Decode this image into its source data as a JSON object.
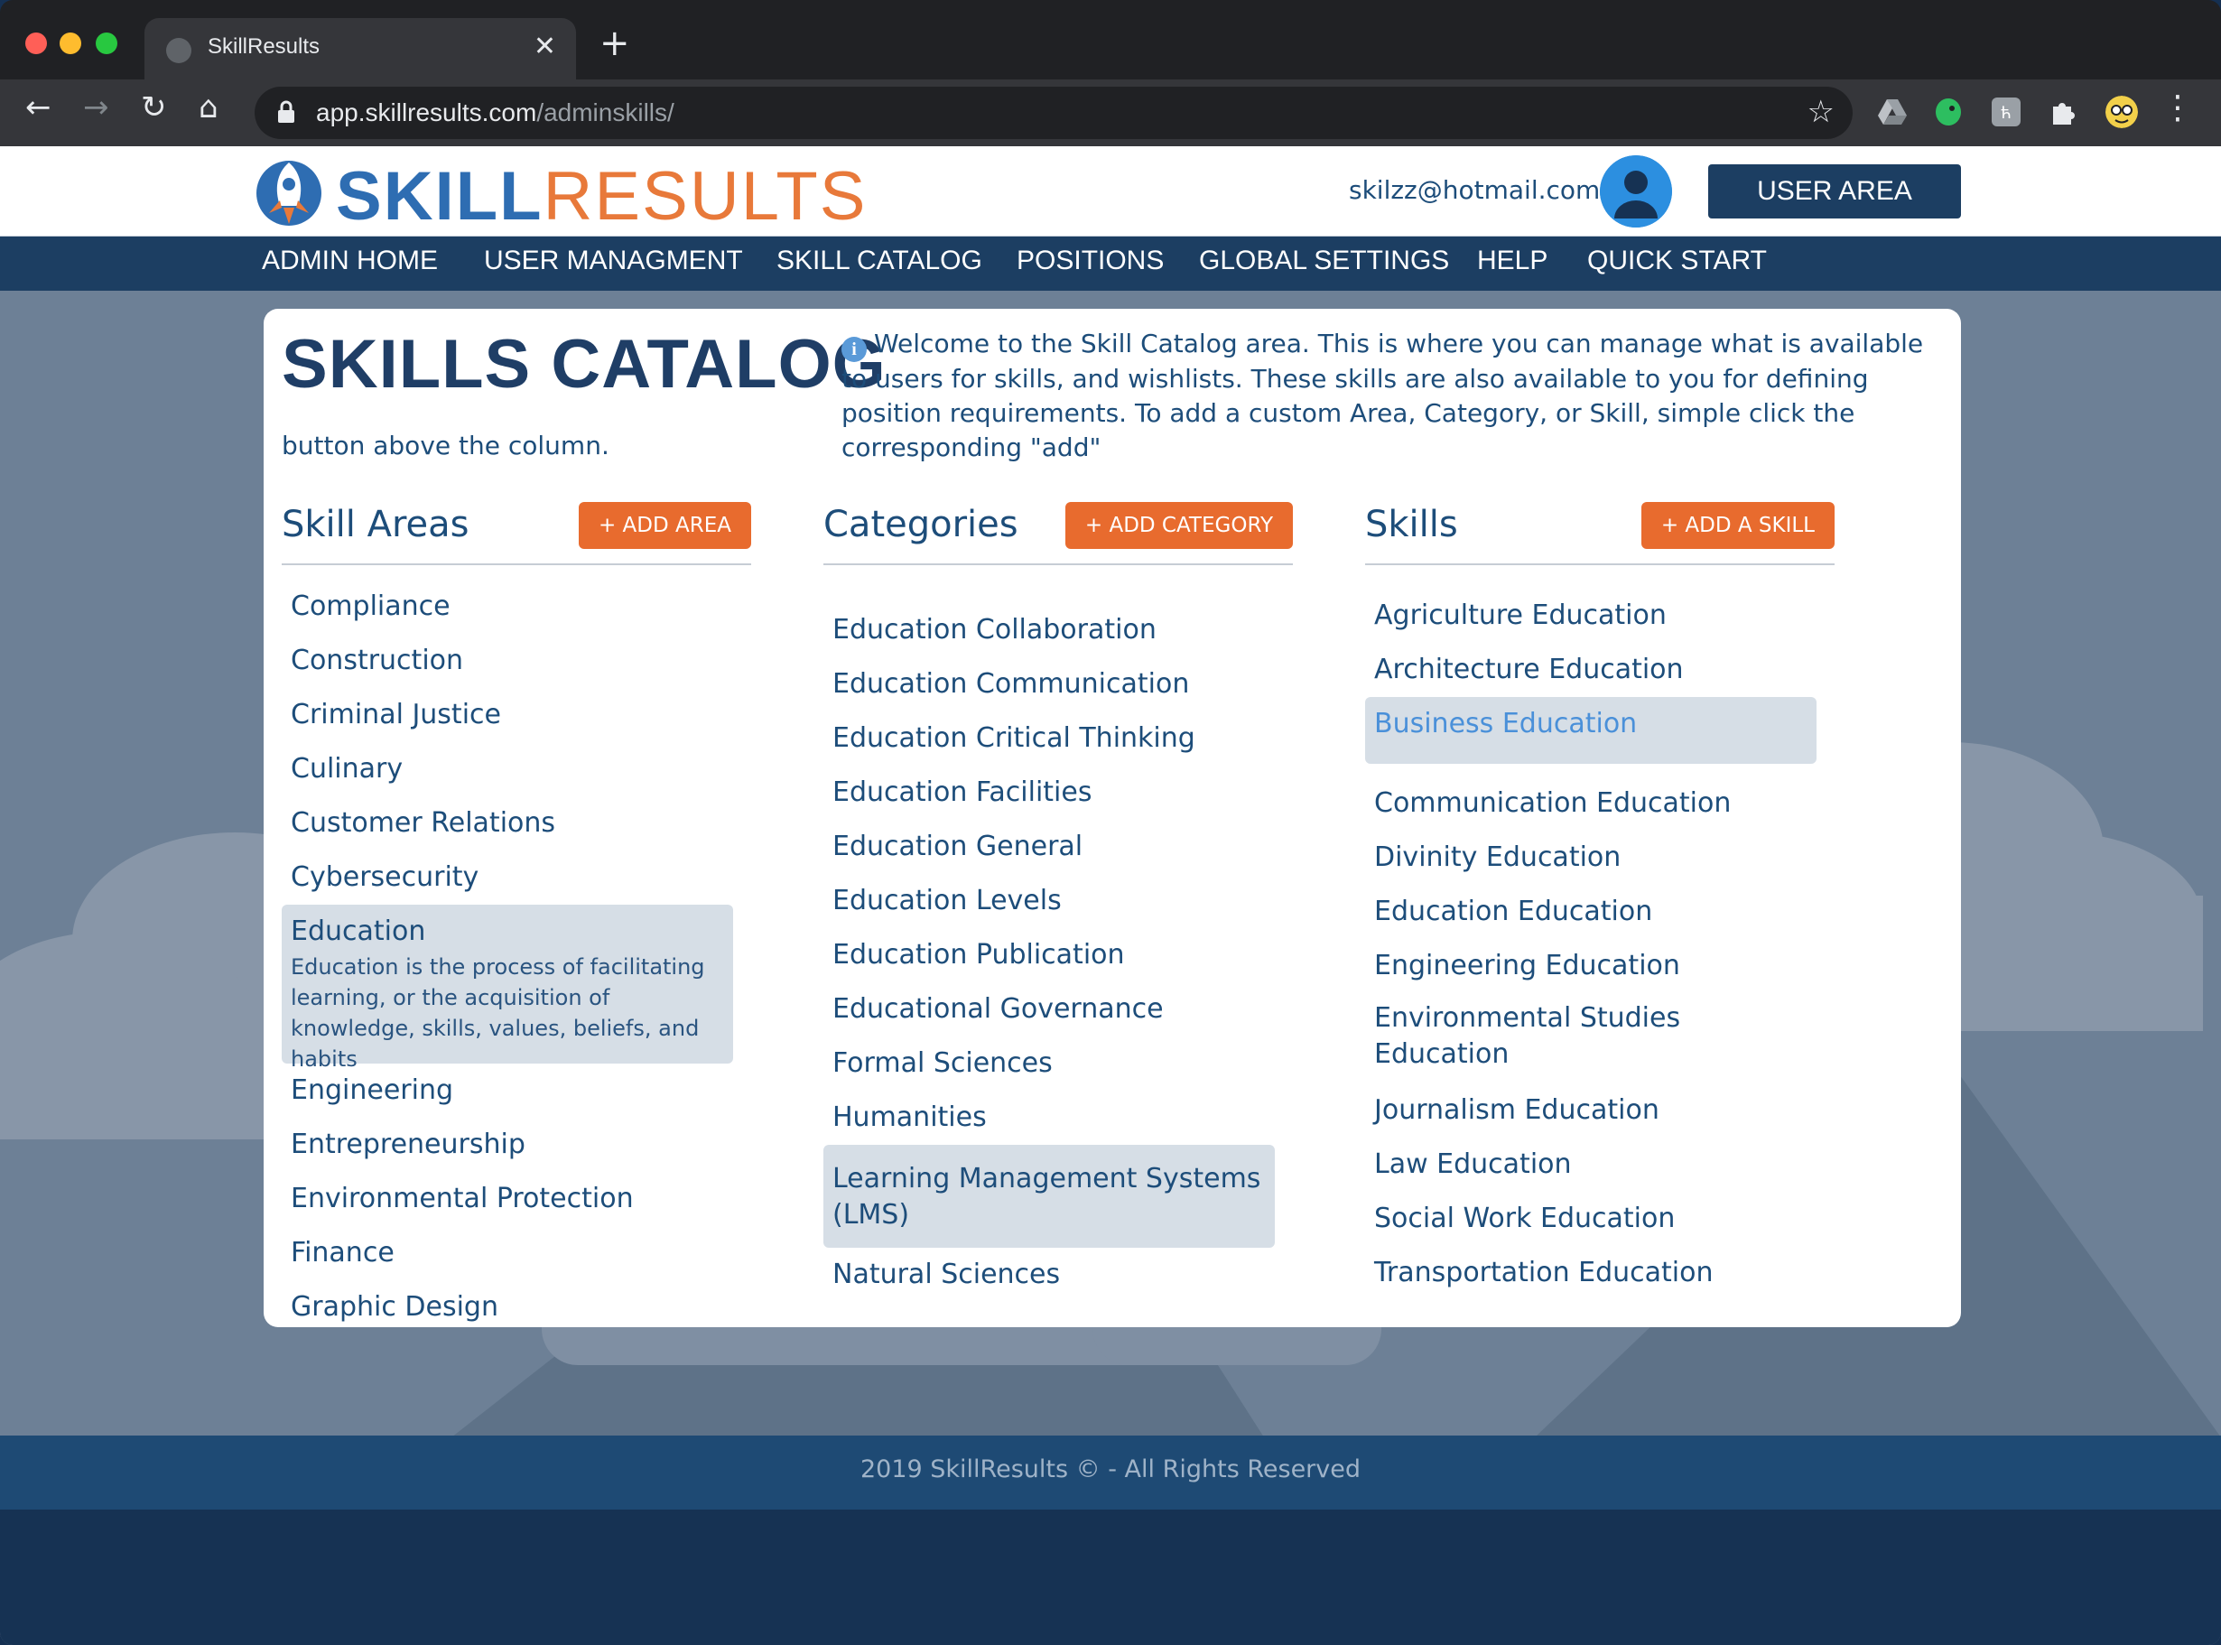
{
  "browser": {
    "tab_title": "SkillResults",
    "url_host": "app.skillresults.com",
    "url_path": "/adminskills/"
  },
  "header": {
    "logo_skill": "SKILL",
    "logo_results": "RESULTS",
    "email": "skilzz@hotmail.com",
    "user_area": "USER AREA"
  },
  "nav": [
    "ADMIN HOME",
    "USER MANAGMENT",
    "SKILL CATALOG",
    "POSITIONS",
    "GLOBAL SETTINGS",
    "HELP",
    "QUICK START"
  ],
  "catalog": {
    "title": "SKILLS CATALOG",
    "intro": "Welcome to the Skill Catalog area. This is where you can manage what is available to users for skills, and wishlists. These skills are also available to you for defining position requirements. To add a custom Area, Category, or Skill, simple click the corresponding \"add\"",
    "intro_cont": "button above the column."
  },
  "areas": {
    "title": "Skill Areas",
    "add_label": "+ ADD AREA",
    "items": [
      "Compliance",
      "Construction",
      "Criminal Justice",
      "Culinary",
      "Customer Relations",
      "Cybersecurity"
    ],
    "selected": {
      "label": "Education",
      "description": "Education is the process of facilitating learning, or the acquisition of knowledge, skills, values, beliefs, and habits"
    },
    "items_after": [
      "Engineering",
      "Entrepreneurship",
      "Environmental Protection",
      "Finance",
      "Graphic Design"
    ]
  },
  "categories": {
    "title": "Categories",
    "add_label": "+ ADD CATEGORY",
    "items": [
      "Education Collaboration",
      "Education Communication",
      "Education Critical Thinking",
      "Education Facilities",
      "Education General",
      "Education Levels",
      "Education Publication",
      "Educational Governance",
      "Formal Sciences",
      "Humanities"
    ],
    "selected": "Learning Management Systems (LMS)",
    "items_after": [
      "Natural Sciences"
    ]
  },
  "skills": {
    "title": "Skills",
    "add_label": "+ ADD A SKILL",
    "items_before": [
      "Agriculture Education",
      "Architecture Education"
    ],
    "selected": "Business Education",
    "items_mid": [
      "Communication Education",
      "Divinity Education",
      "Education Education",
      "Engineering Education"
    ],
    "two_line": "Environmental Studies Education",
    "items_after": [
      "Journalism Education",
      "Law Education",
      "Social Work Education",
      "Transportation Education"
    ]
  },
  "footer": "2019 SkillResults © - All Rights Reserved",
  "colors": {
    "navy": "#1c3e62",
    "accent_orange": "#e86b2e",
    "text_blue": "#1d4d7a",
    "selected_bg": "#d6dee6",
    "selected_link": "#4a90d9"
  }
}
